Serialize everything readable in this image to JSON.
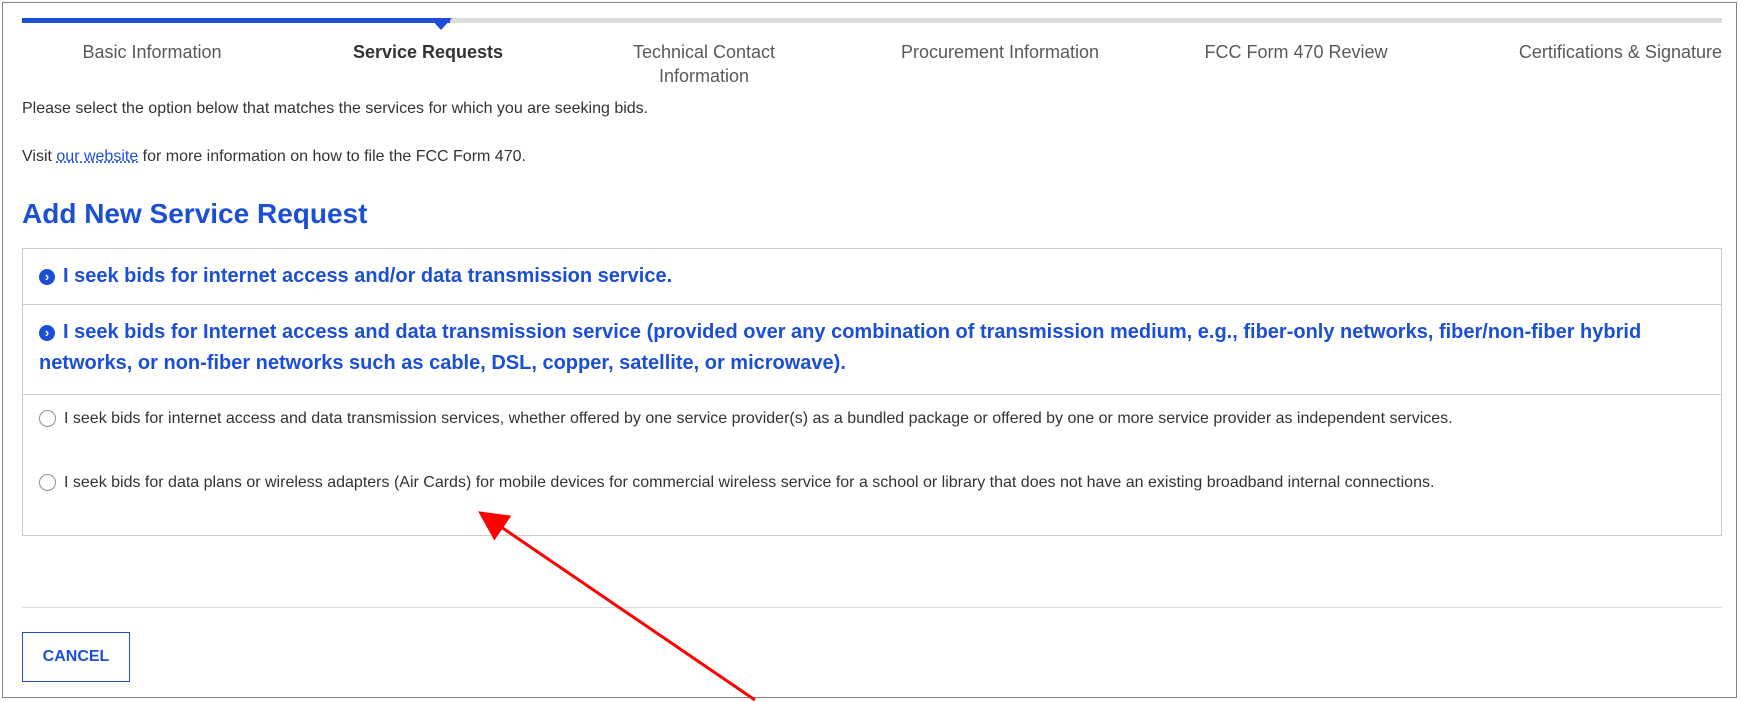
{
  "progress": {
    "steps": [
      {
        "label": "Basic Information",
        "active": false
      },
      {
        "label": "Service Requests",
        "active": true
      },
      {
        "label": "Technical Contact\nInformation",
        "active": false
      },
      {
        "label": "Procurement Information",
        "active": false
      },
      {
        "label": "FCC Form 470 Review",
        "active": false
      },
      {
        "label": "Certifications & Signature",
        "active": false
      }
    ],
    "current_step": 2,
    "total_steps": 6
  },
  "intro": {
    "line1": "Please select the option below that matches the services for which you are seeking bids.",
    "line2_prefix": "Visit ",
    "line2_link": "our website",
    "line2_suffix": " for more information on how to file the FCC Form 470."
  },
  "title": "Add New Service Request",
  "accordion": [
    {
      "label": "I seek bids for internet access and/or data transmission service."
    },
    {
      "label": "I seek bids for Internet access and data transmission service (provided over any combination of transmission medium, e.g., fiber-only networks, fiber/non-fiber hybrid networks, or non-fiber networks such as cable, DSL, copper, satellite, or microwave)."
    }
  ],
  "options": [
    {
      "label": "I seek bids for internet access and data transmission services, whether offered by one service provider(s) as a bundled package or offered by one or more service provider as independent services.",
      "selected": false
    },
    {
      "label": "I seek bids for data plans or wireless adapters (Air Cards) for mobile devices for commercial wireless service for a school or library that does not have an existing broadband internal connections.",
      "selected": false
    }
  ],
  "cancel_label": "CANCEL",
  "colors": {
    "accent": "#1b4fd6",
    "annotation_arrow": "#ff0000"
  }
}
